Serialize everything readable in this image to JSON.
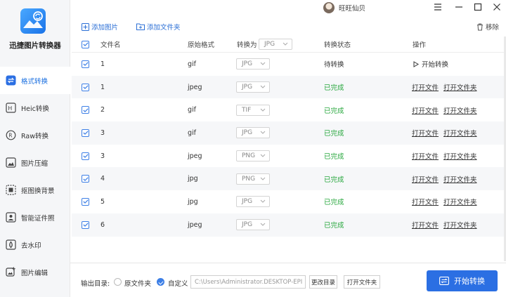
{
  "app": {
    "title": "迅捷图片转换器"
  },
  "sidebar": {
    "items": [
      {
        "label": "格式转换",
        "icon": "format-convert-icon",
        "active": true
      },
      {
        "label": "Heic转换",
        "icon": "heic-icon",
        "active": false
      },
      {
        "label": "Raw转换",
        "icon": "raw-icon",
        "active": false
      },
      {
        "label": "图片压缩",
        "icon": "compress-icon",
        "active": false
      },
      {
        "label": "抠图换背景",
        "icon": "cutout-icon",
        "active": false
      },
      {
        "label": "智能证件照",
        "icon": "id-photo-icon",
        "active": false
      },
      {
        "label": "去水印",
        "icon": "watermark-icon",
        "active": false
      },
      {
        "label": "图片编辑",
        "icon": "image-edit-icon",
        "active": false
      }
    ]
  },
  "titlebar": {
    "username": "旺旺仙贝"
  },
  "toolbar": {
    "add_image": "添加图片",
    "add_folder": "添加文件夹",
    "remove": "移除"
  },
  "table": {
    "headers": {
      "filename": "文件名",
      "orig_format": "原始格式",
      "convert_to": "转换为",
      "convert_to_value": "JPG",
      "status": "转换状态",
      "action": "操作"
    },
    "rows": [
      {
        "name": "1",
        "orig": "gif",
        "target": "JPG",
        "status": "待转换",
        "done": false
      },
      {
        "name": "1",
        "orig": "jpeg",
        "target": "JPG",
        "status": "已完成",
        "done": true
      },
      {
        "name": "2",
        "orig": "gif",
        "target": "TIF",
        "status": "已完成",
        "done": true
      },
      {
        "name": "3",
        "orig": "gif",
        "target": "JPG",
        "status": "已完成",
        "done": true
      },
      {
        "name": "3",
        "orig": "jpeg",
        "target": "PNG",
        "status": "已完成",
        "done": true
      },
      {
        "name": "4",
        "orig": "jpg",
        "target": "PNG",
        "status": "已完成",
        "done": true
      },
      {
        "name": "5",
        "orig": "jpg",
        "target": "JPG",
        "status": "已完成",
        "done": true
      },
      {
        "name": "6",
        "orig": "jpeg",
        "target": "JPG",
        "status": "已完成",
        "done": true
      }
    ],
    "actions": {
      "start": "开始转换",
      "open_file": "打开文件",
      "open_folder": "打开文件夹"
    }
  },
  "bottom": {
    "output_label": "输出目录:",
    "radio_original": "原文件夹",
    "radio_custom": "自定义",
    "path_value": "C:\\Users\\Administrator.DESKTOP-EPI",
    "change_dir": "更改目录",
    "open_folder": "打开文件夹",
    "start_convert": "开始转换"
  },
  "colors": {
    "accent": "#2b6fe3",
    "done": "#27a73d"
  }
}
